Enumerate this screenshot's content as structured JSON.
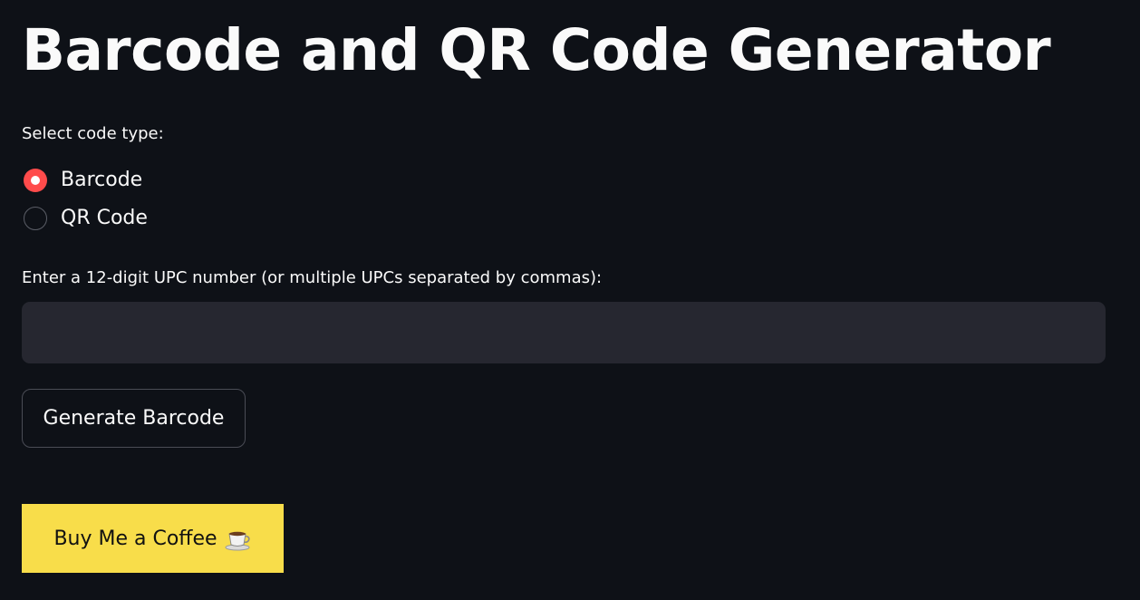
{
  "app": {
    "title": "Barcode and QR Code Generator"
  },
  "code_type": {
    "label": "Select code type:",
    "options": [
      {
        "label": "Barcode",
        "selected": true
      },
      {
        "label": "QR Code",
        "selected": false
      }
    ]
  },
  "upc_input": {
    "label": "Enter a 12-digit UPC number (or multiple UPCs separated by commas):",
    "value": "",
    "placeholder": ""
  },
  "generate_button": {
    "label": "Generate Barcode"
  },
  "coffee_button": {
    "label": "Buy Me a Coffee",
    "icon": "coffee-icon"
  },
  "colors": {
    "background": "#0e1117",
    "text": "#fafafa",
    "accent": "#ff4b4b",
    "input_background": "#262730",
    "coffee_button": "#f8dd4a"
  }
}
